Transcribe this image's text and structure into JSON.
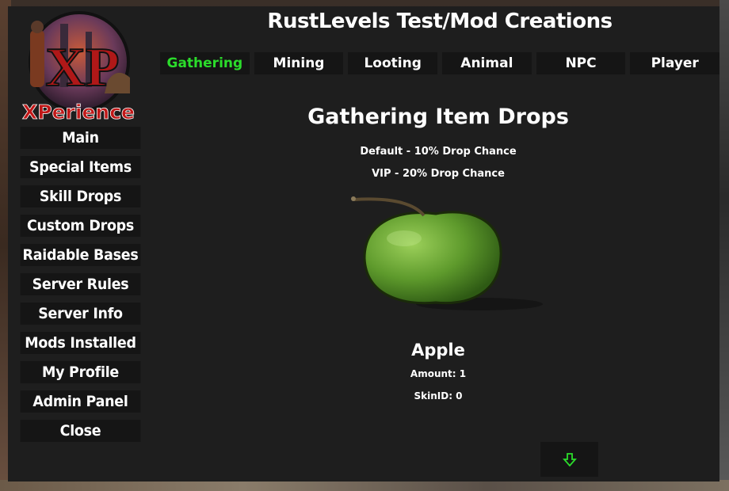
{
  "header": {
    "title": "RustLevels Test/Mod Creations"
  },
  "logo": {
    "big_text": "XP",
    "sub_text": "XPerience"
  },
  "sidebar": {
    "items": [
      {
        "label": "Main"
      },
      {
        "label": "Special Items"
      },
      {
        "label": "Skill Drops"
      },
      {
        "label": "Custom Drops"
      },
      {
        "label": "Raidable Bases"
      },
      {
        "label": "Server Rules"
      },
      {
        "label": "Server Info"
      },
      {
        "label": "Mods Installed"
      },
      {
        "label": "My Profile"
      },
      {
        "label": "Admin Panel"
      },
      {
        "label": "Close"
      }
    ]
  },
  "tabs": [
    {
      "label": "Gathering",
      "active": true
    },
    {
      "label": "Mining"
    },
    {
      "label": "Looting"
    },
    {
      "label": "Animal"
    },
    {
      "label": "NPC"
    },
    {
      "label": "Player"
    }
  ],
  "content": {
    "section_title": "Gathering Item Drops",
    "default_chance": "Default - 10%  Drop Chance",
    "vip_chance": "VIP - 20%  Drop Chance",
    "item": {
      "name": "Apple",
      "amount": "Amount: 1",
      "skin_id": "SkinID: 0"
    }
  },
  "colors": {
    "active_tab": "#2bdc2b",
    "panel": "#1e1e1e",
    "button": "#151515",
    "logo_red": "#c01818"
  },
  "icons": {
    "next": "arrow-down-icon"
  }
}
